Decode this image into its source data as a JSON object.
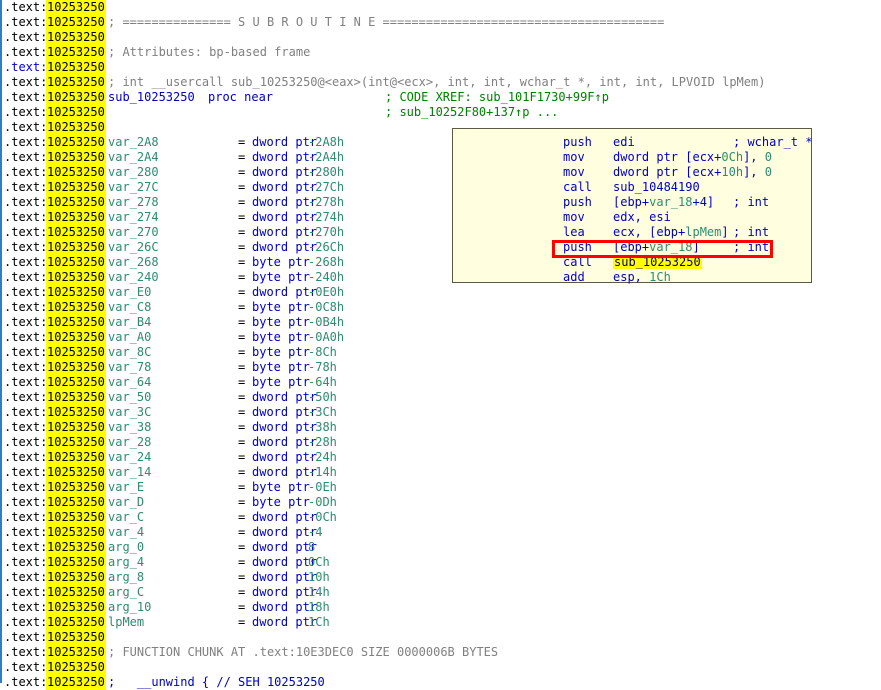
{
  "view": {
    "segment": ".text",
    "address": "10253250",
    "colors": {
      "address_highlight": "#ffff00",
      "comment": "#808080",
      "xref": "#008000",
      "keyword": "#0000c0",
      "local_var": "#2e8b6e",
      "hint_background": "#ffffe0",
      "emphasis_box": "#ff0000",
      "current_line": "#0000d0"
    }
  },
  "header": {
    "subroutine_banner": "; =============== S U B R O U T I N E =======================================",
    "attributes": "; Attributes: bp-based frame",
    "prototype": "; int __usercall sub_10253250@<eax>(int@<ecx>, int, int, wchar_t *, int, int, LPVOID lpMem)",
    "proc_name": "sub_10253250",
    "proc_directive": "proc near",
    "xref_line_1": "; CODE XREF: sub_101F1730+99F↑p",
    "xref_line_2": "; sub_10252F80+137↑p ..."
  },
  "stack_variables": [
    {
      "name": "var_2A8",
      "eq": "=",
      "type": "dword ptr",
      "value": "-2A8h"
    },
    {
      "name": "var_2A4",
      "eq": "=",
      "type": "dword ptr",
      "value": "-2A4h"
    },
    {
      "name": "var_280",
      "eq": "=",
      "type": "dword ptr",
      "value": "-280h"
    },
    {
      "name": "var_27C",
      "eq": "=",
      "type": "dword ptr",
      "value": "-27Ch"
    },
    {
      "name": "var_278",
      "eq": "=",
      "type": "dword ptr",
      "value": "-278h"
    },
    {
      "name": "var_274",
      "eq": "=",
      "type": "dword ptr",
      "value": "-274h"
    },
    {
      "name": "var_270",
      "eq": "=",
      "type": "dword ptr",
      "value": "-270h"
    },
    {
      "name": "var_26C",
      "eq": "=",
      "type": "dword ptr",
      "value": "-26Ch"
    },
    {
      "name": "var_268",
      "eq": "=",
      "type": "byte ptr",
      "value": "-268h"
    },
    {
      "name": "var_240",
      "eq": "=",
      "type": "byte ptr",
      "value": "-240h"
    },
    {
      "name": "var_E0",
      "eq": "=",
      "type": "dword ptr",
      "value": "-0E0h"
    },
    {
      "name": "var_C8",
      "eq": "=",
      "type": "byte ptr",
      "value": "-0C8h"
    },
    {
      "name": "var_B4",
      "eq": "=",
      "type": "byte ptr",
      "value": "-0B4h"
    },
    {
      "name": "var_A0",
      "eq": "=",
      "type": "byte ptr",
      "value": "-0A0h"
    },
    {
      "name": "var_8C",
      "eq": "=",
      "type": "byte ptr",
      "value": "-8Ch"
    },
    {
      "name": "var_78",
      "eq": "=",
      "type": "byte ptr",
      "value": "-78h"
    },
    {
      "name": "var_64",
      "eq": "=",
      "type": "byte ptr",
      "value": "-64h"
    },
    {
      "name": "var_50",
      "eq": "=",
      "type": "dword ptr",
      "value": "-50h"
    },
    {
      "name": "var_3C",
      "eq": "=",
      "type": "dword ptr",
      "value": "-3Ch"
    },
    {
      "name": "var_38",
      "eq": "=",
      "type": "dword ptr",
      "value": "-38h"
    },
    {
      "name": "var_28",
      "eq": "=",
      "type": "dword ptr",
      "value": "-28h"
    },
    {
      "name": "var_24",
      "eq": "=",
      "type": "dword ptr",
      "value": "-24h"
    },
    {
      "name": "var_14",
      "eq": "=",
      "type": "dword ptr",
      "value": "-14h"
    },
    {
      "name": "var_E",
      "eq": "=",
      "type": "byte ptr",
      "value": "-0Eh"
    },
    {
      "name": "var_D",
      "eq": "=",
      "type": "byte ptr",
      "value": "-0Dh"
    },
    {
      "name": "var_C",
      "eq": "=",
      "type": "dword ptr",
      "value": "-0Ch"
    },
    {
      "name": "var_4",
      "eq": "=",
      "type": "dword ptr",
      "value": "-4"
    },
    {
      "name": "arg_0",
      "eq": "=",
      "type": "dword ptr",
      "value": "8"
    },
    {
      "name": "arg_4",
      "eq": "=",
      "type": "dword ptr",
      "value": "0Ch"
    },
    {
      "name": "arg_8",
      "eq": "=",
      "type": "dword ptr",
      "value": "10h"
    },
    {
      "name": "arg_C",
      "eq": "=",
      "type": "dword ptr",
      "value": "14h"
    },
    {
      "name": "arg_10",
      "eq": "=",
      "type": "dword ptr",
      "value": "18h"
    },
    {
      "name": "lpMem",
      "eq": "=",
      "type": "dword ptr",
      "value": "1Ch"
    }
  ],
  "footer": {
    "function_chunk": "; FUNCTION CHUNK AT .text:10E3DEC0 SIZE 0000006B BYTES",
    "unwind": ";   __unwind { // SEH 10253250"
  },
  "hint_panel": {
    "highlighted_target": "sub_10253250",
    "lines": [
      {
        "mnemonic": "push",
        "operand": "edi",
        "comment": "; wchar_t *",
        "highlight": false
      },
      {
        "mnemonic": "mov",
        "operand": "dword ptr [ecx+0Ch], 0",
        "comment": "",
        "highlight": false
      },
      {
        "mnemonic": "mov",
        "operand": "dword ptr [ecx+10h], 0",
        "comment": "",
        "highlight": false
      },
      {
        "mnemonic": "call",
        "operand": "sub_10484190",
        "comment": "",
        "highlight": false
      },
      {
        "mnemonic": "push",
        "operand": "[ebp+var_18+4]",
        "comment": "; int",
        "highlight": false
      },
      {
        "mnemonic": "mov",
        "operand": "edx, esi",
        "comment": "",
        "highlight": false
      },
      {
        "mnemonic": "lea",
        "operand": "ecx, [ebp+lpMem]",
        "comment": "; int",
        "highlight": false
      },
      {
        "mnemonic": "push",
        "operand": "[ebp+var_18]",
        "comment": "; int",
        "highlight": false
      },
      {
        "mnemonic": "call",
        "operand": "sub_10253250",
        "comment": "",
        "highlight": true
      },
      {
        "mnemonic": "add",
        "operand": "esp, 1Ch",
        "comment": "",
        "highlight": false
      }
    ]
  }
}
